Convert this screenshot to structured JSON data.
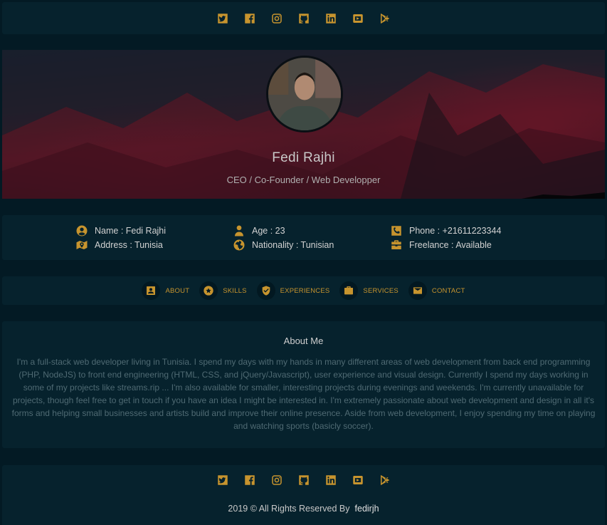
{
  "social": [
    {
      "icon": "twitter-icon"
    },
    {
      "icon": "facebook-icon"
    },
    {
      "icon": "instagram-icon"
    },
    {
      "icon": "github-icon"
    },
    {
      "icon": "linkedin-icon"
    },
    {
      "icon": "youtube-icon"
    },
    {
      "icon": "google-play-icon"
    }
  ],
  "profile": {
    "name": "Fedi Rajhi",
    "role": "CEO / Co-Founder / Web Developper"
  },
  "info": {
    "name": "Name : Fedi Rajhi",
    "address": "Address : Tunisia",
    "age": "Age : 23",
    "nationality": "Nationality : Tunisian",
    "phone": "Phone : +21611223344",
    "freelance": "Freelance : Available"
  },
  "nav": {
    "about": "ABOUT",
    "skills": "SKILLS",
    "experiences": "EXPERIENCES",
    "services": "SERVICES",
    "contact": "CONTACT"
  },
  "about": {
    "title": "About Me",
    "text": "I'm a full-stack web developer living in Tunisia. I spend my days with my hands in many different areas of web development from back end programming (PHP, NodeJS) to front end engineering (HTML, CSS, and jQuery/Javascript), user experience and visual design. Currently I spend my days working in some of my projects like streams.rip ... I'm also available for smaller, interesting projects during evenings and weekends. I'm currently unavailable for projects, though feel free to get in touch if you have an idea I might be interested in. I'm extremely passionate about web development and design in all it's forms and helping small businesses and artists build and improve their online presence. Aside from web development, I enjoy spending my time on playing and watching sports (basicly soccer)."
  },
  "footer": {
    "copyright": "2019 © All Rights Reserved By",
    "author": "fedirjh"
  },
  "colors": {
    "accent": "#c7942e",
    "background": "#031a24",
    "panel": "#06222d"
  }
}
